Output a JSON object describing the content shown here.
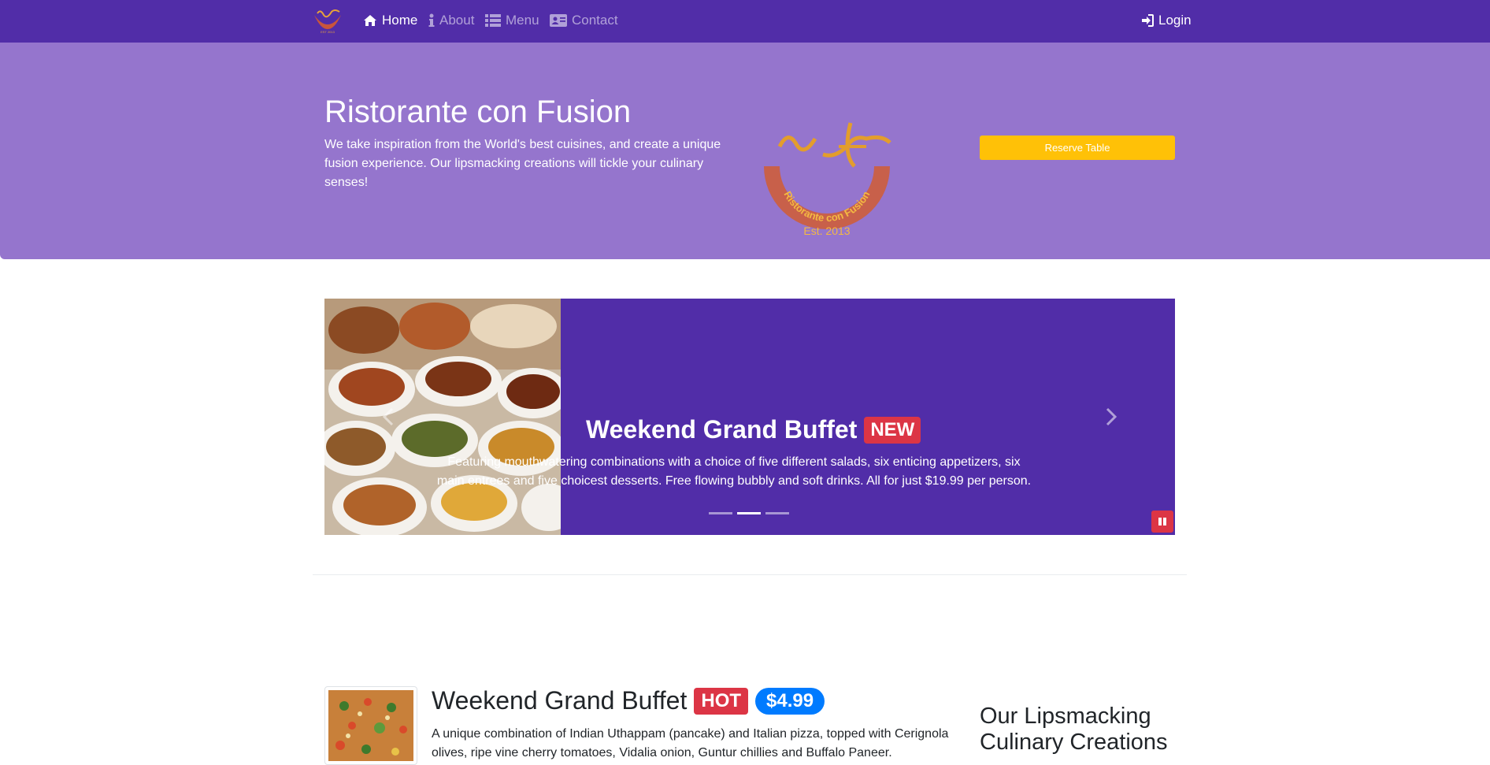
{
  "nav": {
    "home": "Home",
    "about": "About",
    "menu": "Menu",
    "contact": "Contact",
    "login": "Login"
  },
  "icons": {
    "home": "home-icon",
    "about": "info-icon",
    "menu": "list-icon",
    "contact": "address-card-icon",
    "login": "sign-in-icon"
  },
  "hero": {
    "title": "Ristorante con Fusion",
    "text": "We take inspiration from the World's best cuisines, and create a unique fusion experience. Our lipsmacking creations will tickle your culinary senses!",
    "reserve_label": "Reserve Table",
    "logo_text": "Ristorante con Fusion",
    "logo_est": "Est. 2013"
  },
  "carousel": {
    "heading": "Weekend Grand Buffet",
    "badge": "NEW",
    "caption": "Featuring mouthwatering combinations with a choice of five different salads, six enticing appetizers, six main entrees and five choicest desserts. Free flowing bubbly and soft drinks. All for just $19.99 per person.",
    "active_slide": 2,
    "slide_count": 3
  },
  "featured": {
    "title": "Weekend Grand Buffet",
    "badge_hot": "HOT",
    "price": "$4.99",
    "description": "A unique combination of Indian Uthappam (pancake) and Italian pizza, topped with Cerignola olives, ripe vine cherry tomatoes, Vidalia onion, Guntur chillies and Buffalo Paneer."
  },
  "sidebar": {
    "heading": "Our Lipsmacking Culinary Creations"
  },
  "colors": {
    "primary_dark": "#512DA8",
    "primary_light": "#9575CD",
    "warning": "#FFC107",
    "danger": "#DC3545",
    "info": "#007BFF"
  }
}
